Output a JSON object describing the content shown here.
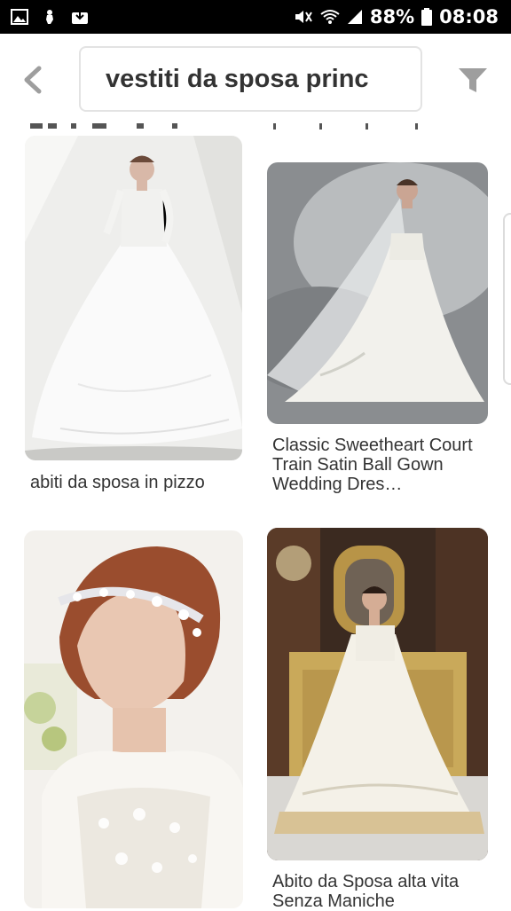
{
  "status_bar": {
    "battery_percent": "88%",
    "time": "08:08",
    "left_icons": [
      "image-icon",
      "touch-icon",
      "download-box-icon"
    ],
    "right_icons": [
      "mute-icon",
      "wifi-icon",
      "signal-icon",
      "battery-icon"
    ]
  },
  "header": {
    "back_icon": "chevron-left-icon",
    "search_query": "vestiti da sposa princ",
    "filter_icon": "filter-icon"
  },
  "pins": [
    {
      "caption": "abiti da sposa in pizzo",
      "image": "wedding-gown-lace-long-sleeve-photo"
    },
    {
      "caption": "Classic Sweetheart Court Train Satin Ball Gown Wedding Dres…",
      "image": "wedding-gown-veil-grey-background-photo"
    },
    {
      "caption": "",
      "image": "bride-hair-accessory-lace-top-photo"
    },
    {
      "caption": "Abito da Sposa alta vita Senza Maniche",
      "image": "wedding-gown-gold-interior-photo"
    }
  ],
  "colors": {
    "status_bar_bg": "#000000",
    "icon_grey": "#9e9e9e",
    "caption_text": "#333333",
    "search_border": "#e3e3e3"
  }
}
